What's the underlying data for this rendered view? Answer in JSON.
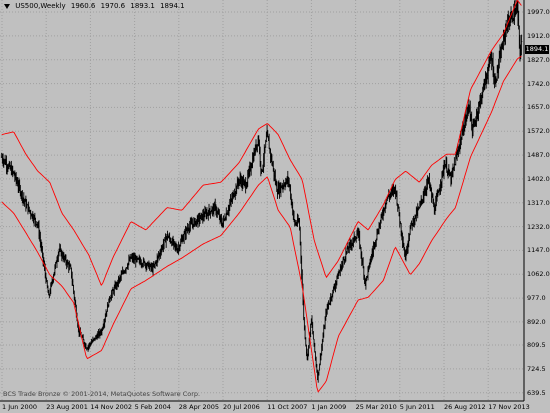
{
  "header": {
    "symbol": "US500,Weekly",
    "open": "1960.6",
    "high": "1970.6",
    "low": "1893.1",
    "close": "1894.1"
  },
  "copyright": "BCS Trade Bronze © 2001-2014, MetaQuotes Software Corp.",
  "current_price_label": "1894.1",
  "colors": {
    "background": "#c0c0c0",
    "bars": "#000000",
    "bands": "#ff0000",
    "grid": "#a0a0a0",
    "price_tag": "#000000"
  },
  "chart_data": {
    "type": "line",
    "y_ticks": [
      "1997.0",
      "1912.0",
      "1827.0",
      "1742.0",
      "1657.0",
      "1572.0",
      "1487.0",
      "1402.0",
      "1317.0",
      "1232.0",
      "1147.0",
      "1062.0",
      "977.0",
      "892.0",
      "809.5",
      "724.5",
      "639.5"
    ],
    "x_ticks": [
      "1 Jun 2000",
      "23 Aug 2001",
      "14 Nov 2002",
      "5 Feb 2004",
      "28 Apr 2005",
      "20 Jul 2006",
      "11 Oct 2007",
      "1 Jan 2009",
      "25 Mar 2010",
      "5 Jun 2011",
      "26 Aug 2012",
      "17 Nov 2013"
    ],
    "ylim": [
      610,
      2040
    ],
    "grid": true,
    "series": [
      {
        "role": "price",
        "x": [
          "2000-06-01",
          "2000-10-01",
          "2001-02-01",
          "2001-06-01",
          "2001-09-20",
          "2002-01-01",
          "2002-05-01",
          "2002-07-20",
          "2002-10-10",
          "2003-03-10",
          "2003-06-01",
          "2004-01-01",
          "2004-06-01",
          "2004-08-10",
          "2005-01-01",
          "2005-04-15",
          "2005-08-01",
          "2006-01-01",
          "2006-05-01",
          "2006-07-15",
          "2007-01-01",
          "2007-03-10",
          "2007-07-15",
          "2007-08-15",
          "2007-10-10",
          "2008-01-20",
          "2008-05-15",
          "2008-07-15",
          "2008-09-01",
          "2008-10-20",
          "2008-11-20",
          "2009-01-01",
          "2009-03-06",
          "2009-06-01",
          "2009-10-01",
          "2010-01-01",
          "2010-04-20",
          "2010-07-01",
          "2010-10-01",
          "2011-02-01",
          "2011-05-01",
          "2011-08-10",
          "2011-10-01",
          "2012-01-01",
          "2012-04-01",
          "2012-06-01",
          "2012-09-15",
          "2012-11-15",
          "2013-05-20",
          "2013-06-20",
          "2013-12-31",
          "2014-02-01",
          "2014-06-01",
          "2014-09-19",
          "2014-10-15",
          "2014-10-31"
        ],
        "values": [
          1480,
          1420,
          1310,
          1240,
          980,
          1150,
          1080,
          860,
          800,
          860,
          980,
          1120,
          1100,
          1080,
          1200,
          1150,
          1230,
          1270,
          1300,
          1240,
          1400,
          1380,
          1550,
          1420,
          1560,
          1360,
          1400,
          1240,
          1250,
          880,
          760,
          900,
          690,
          930,
          1060,
          1150,
          1210,
          1030,
          1170,
          1330,
          1370,
          1120,
          1230,
          1300,
          1400,
          1290,
          1460,
          1400,
          1670,
          1570,
          1840,
          1740,
          1950,
          2010,
          1850,
          1894
        ]
      },
      {
        "role": "upper-band",
        "x": [
          "2000-06-01",
          "2000-10-01",
          "2001-02-01",
          "2001-06-01",
          "2001-10-01",
          "2002-02-01",
          "2002-06-01",
          "2002-11-01",
          "2003-03-10",
          "2003-07-01",
          "2004-01-01",
          "2004-06-01",
          "2005-01-01",
          "2005-06-01",
          "2006-01-01",
          "2006-07-01",
          "2007-01-01",
          "2007-07-15",
          "2007-10-15",
          "2008-02-01",
          "2008-06-01",
          "2008-10-01",
          "2009-02-01",
          "2009-06-01",
          "2009-10-01",
          "2010-04-20",
          "2010-08-01",
          "2011-01-01",
          "2011-05-01",
          "2011-08-15",
          "2012-01-01",
          "2012-05-01",
          "2012-10-01",
          "2013-01-01",
          "2013-06-01",
          "2013-12-31",
          "2014-05-01",
          "2014-09-19",
          "2014-10-31"
        ],
        "values": [
          1560,
          1570,
          1490,
          1430,
          1390,
          1280,
          1220,
          1130,
          1020,
          1120,
          1250,
          1220,
          1300,
          1290,
          1380,
          1390,
          1460,
          1580,
          1600,
          1560,
          1470,
          1400,
          1180,
          1050,
          1110,
          1250,
          1220,
          1310,
          1400,
          1430,
          1390,
          1450,
          1490,
          1490,
          1720,
          1860,
          1920,
          2040,
          2020
        ]
      },
      {
        "role": "lower-band",
        "x": [
          "2000-06-01",
          "2000-10-01",
          "2001-02-01",
          "2001-06-01",
          "2001-10-01",
          "2002-02-01",
          "2002-06-01",
          "2002-10-10",
          "2003-03-10",
          "2003-07-01",
          "2004-01-01",
          "2004-06-01",
          "2005-01-01",
          "2005-06-01",
          "2006-01-01",
          "2006-07-01",
          "2007-01-01",
          "2007-07-15",
          "2007-10-15",
          "2008-02-01",
          "2008-06-01",
          "2008-10-01",
          "2009-03-06",
          "2009-06-01",
          "2009-10-01",
          "2010-04-20",
          "2010-08-01",
          "2011-01-01",
          "2011-05-01",
          "2011-10-01",
          "2012-01-01",
          "2012-05-01",
          "2012-10-01",
          "2013-01-01",
          "2013-06-01",
          "2013-12-31",
          "2014-05-01",
          "2014-09-19",
          "2014-10-31"
        ],
        "values": [
          1320,
          1280,
          1210,
          1140,
          1060,
          1020,
          960,
          760,
          790,
          880,
          1010,
          1040,
          1090,
          1120,
          1170,
          1200,
          1280,
          1380,
          1410,
          1290,
          1230,
          1020,
          640,
          680,
          840,
          970,
          980,
          1040,
          1160,
          1060,
          1100,
          1180,
          1260,
          1300,
          1480,
          1640,
          1750,
          1830,
          1840
        ]
      }
    ]
  }
}
